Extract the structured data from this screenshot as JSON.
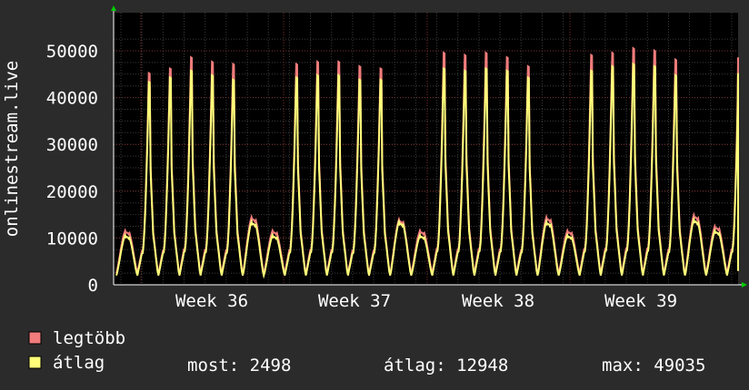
{
  "chart_data": {
    "type": "area",
    "ylabel": "onlinestream.live",
    "ylim": [
      0,
      55000
    ],
    "y_ticks": [
      "0",
      "10000",
      "20000",
      "30000",
      "40000",
      "50000"
    ],
    "x_ticks": [
      "Week 36",
      "Week 37",
      "Week 38",
      "Week 39"
    ],
    "grid": true,
    "series": [
      {
        "name": "legtöbb",
        "color": "#f07c7c",
        "daily_peaks": [
          12000,
          47000,
          48000,
          50500,
          49500,
          49000,
          15000,
          12000,
          49000,
          49500,
          49500,
          48500,
          48000,
          14500,
          12000,
          51500,
          51000,
          51500,
          50500,
          48500,
          15000,
          12000,
          51000,
          51500,
          52500,
          52000,
          50000,
          15500,
          13000,
          50500
        ]
      },
      {
        "name": "átlag",
        "color": "#ffff7a",
        "daily_peaks": [
          11000,
          45000,
          46000,
          47500,
          46500,
          45500,
          14000,
          11000,
          46000,
          46500,
          46500,
          45500,
          45500,
          14000,
          11000,
          48000,
          47500,
          48000,
          47500,
          46000,
          14000,
          11000,
          47500,
          48500,
          49000,
          48500,
          46500,
          14500,
          12000,
          47000
        ]
      }
    ]
  },
  "legend": {
    "items": [
      {
        "label": "legtöbb",
        "color": "#f07c7c"
      },
      {
        "label": "átlag",
        "color": "#ffff7a"
      }
    ]
  },
  "stats": {
    "most": "most: 2498",
    "atlag": "átlag: 12948",
    "max": "max: 49035"
  }
}
